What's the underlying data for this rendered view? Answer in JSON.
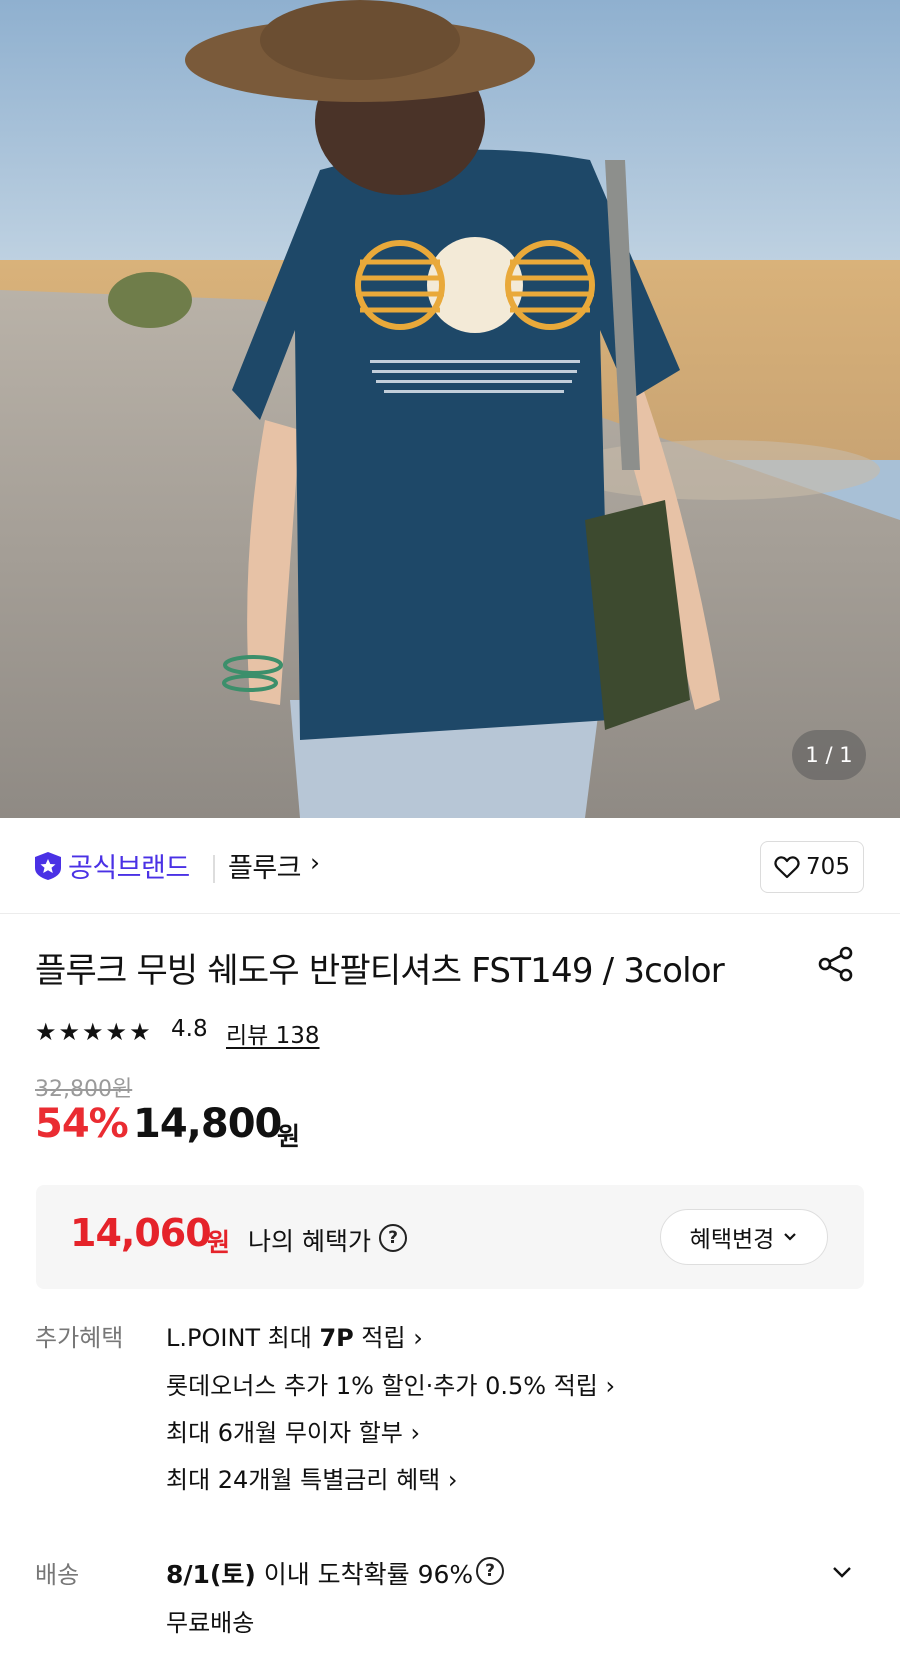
{
  "gallery": {
    "counter": "1 / 1"
  },
  "brand": {
    "official_label": "공식브랜드",
    "name": "플루크",
    "chevron": "›",
    "likes": "705"
  },
  "product": {
    "title": "플루크 무빙 쉐도우 반팔티셔츠 FST149 / 3color",
    "rating": "4.8",
    "review_label": "리뷰 138",
    "original_price": "32,800원",
    "discount": "54%",
    "price": "14,800",
    "price_unit": "원"
  },
  "benefit": {
    "price": "14,060",
    "unit": "원",
    "label": "나의 혜택가",
    "help": "?",
    "change_button": "혜택변경"
  },
  "extra_benefits": {
    "label": "추가혜택",
    "line1_prefix": "L.POINT 최대 ",
    "line1_bold": "7P",
    "line1_suffix": " 적립 ›",
    "line2": "롯데오너스 추가 1% 할인·추가 0.5% 적립 ›",
    "line3": "최대 6개월 무이자 할부 ›",
    "line4": "최대 24개월 특별금리 혜택 ›"
  },
  "shipping": {
    "label": "배송",
    "date": "8/1(토)",
    "date_suffix": " 이내 도착확률 96%",
    "help": "?",
    "free": "무료배송"
  },
  "colors": {
    "brand_purple": "#4a31e5",
    "sale_red": "#ea2c32"
  }
}
